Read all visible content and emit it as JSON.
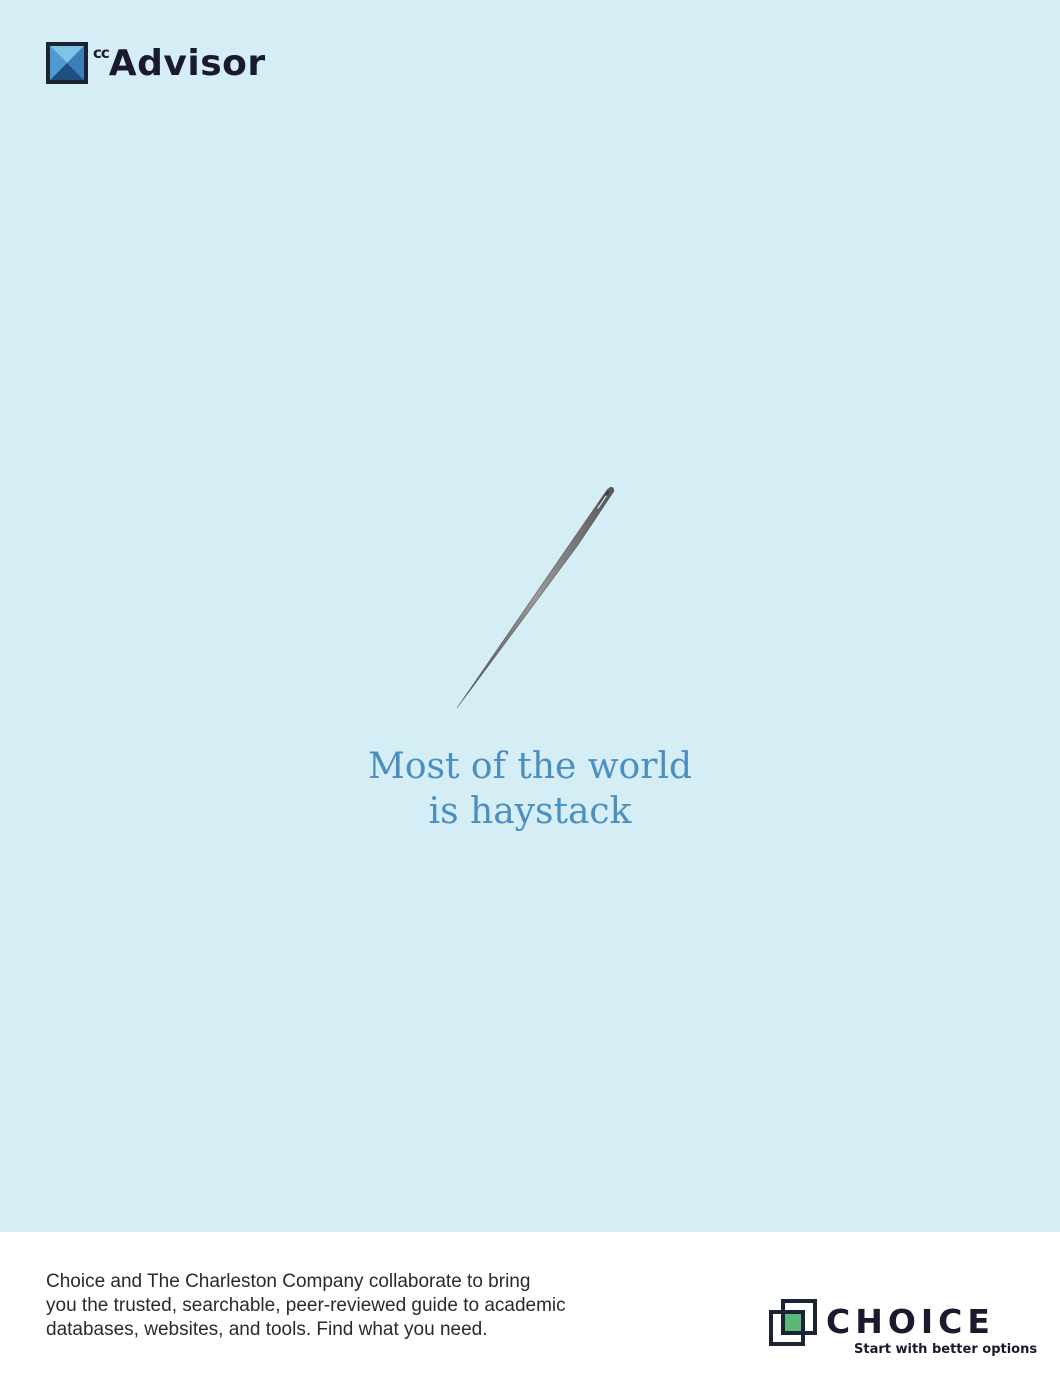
{
  "brand": {
    "cc_superscript": "cc",
    "advisor_word": "Advisor"
  },
  "hero": {
    "headline_line1": "Most of the world",
    "headline_line2": "is haystack",
    "background_color": "#d5edf5",
    "headline_color": "#4b8fc0"
  },
  "footer": {
    "body_line1": "Choice and The Charleston Company collaborate to bring",
    "body_line2": "you the trusted, searchable, peer-reviewed guide to academic",
    "body_line3": "databases, websites, and tools. Find what you need.",
    "choice_word": "CHOICE",
    "choice_tagline": "Start with better options"
  }
}
